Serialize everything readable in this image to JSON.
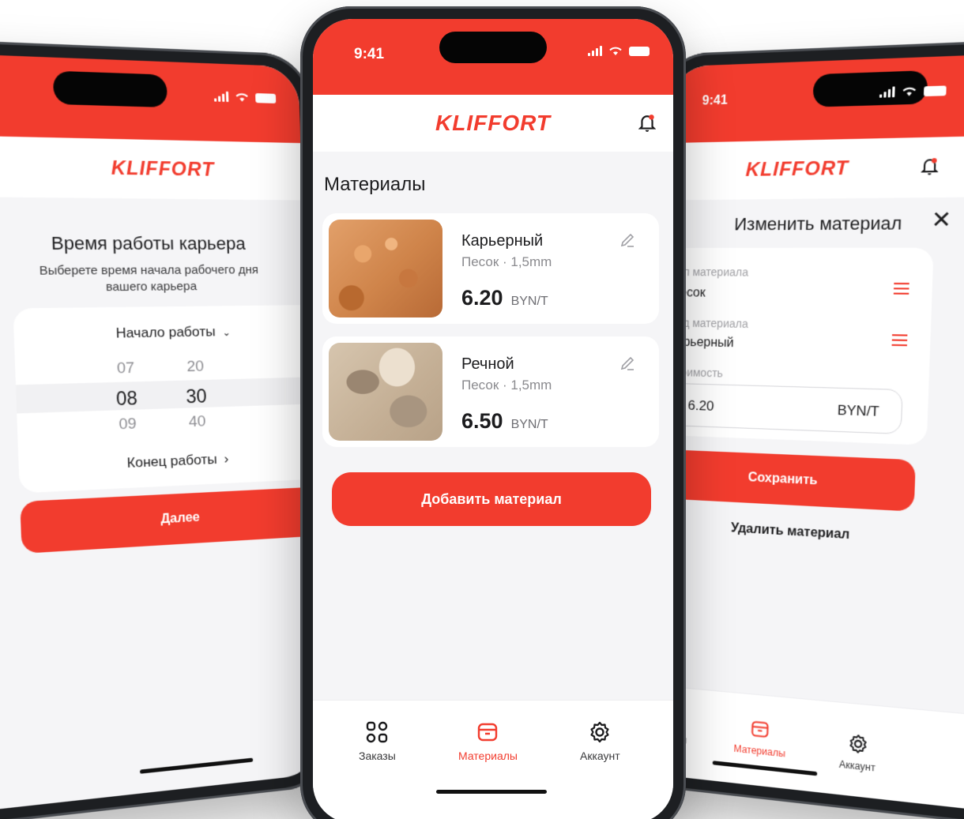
{
  "brand": {
    "logo": "KLIFFORT",
    "accent": "#f23c2e"
  },
  "status": {
    "time": "9:41"
  },
  "left_screen": {
    "title": "Время работы карьера",
    "subtitle": "Выберете время начала рабочего дня вашего карьера",
    "start_label": "Начало работы",
    "picker": {
      "hours": [
        "07",
        "08",
        "09"
      ],
      "minutes": [
        "20",
        "30",
        "40"
      ],
      "selected_hour": "08",
      "selected_minute": "30"
    },
    "end_label": "Конец работы",
    "next_button": "Далее"
  },
  "center_screen": {
    "section_title": "Материалы",
    "materials": [
      {
        "name": "Карьерный",
        "details": "Песок · 1,5mm",
        "price": "6.20",
        "unit": "BYN/T",
        "image": "quarry-sand"
      },
      {
        "name": "Речной",
        "details": "Песок · 1,5mm",
        "price": "6.50",
        "unit": "BYN/T",
        "image": "river-sand"
      }
    ],
    "add_button": "Добавить материал"
  },
  "right_screen": {
    "title": "Изменить материал",
    "type_label": "Тип материала",
    "type_value": "Песок",
    "kind_label": "Вид материала",
    "kind_value": "Карьерный",
    "cost_label": "Стоимость",
    "cost_value": "6.20",
    "cost_unit": "BYN/T",
    "save_button": "Сохранить",
    "delete_link": "Удалить материал"
  },
  "tabbar": {
    "items": [
      {
        "label": "Заказы",
        "icon": "grid-icon"
      },
      {
        "label": "Материалы",
        "icon": "box-icon"
      },
      {
        "label": "Аккаунт",
        "icon": "gear-icon"
      }
    ],
    "active_index": 1
  }
}
